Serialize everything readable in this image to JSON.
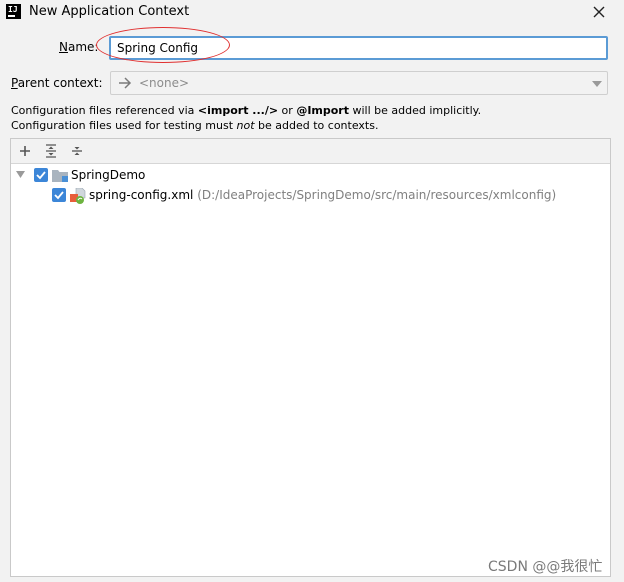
{
  "window": {
    "title": "New Application Context",
    "app_icon": "intellij-idea-icon",
    "app_icon_text": "IJ",
    "close_icon": "close-icon"
  },
  "form": {
    "name_label": "Name:",
    "name_mnemonic": "N",
    "name_rest": "ame:",
    "name_value": "Spring Config",
    "parent_label": "Parent context:",
    "parent_mnemonic": "P",
    "parent_rest": "arent context:",
    "parent_value": "<none>"
  },
  "info": {
    "line1_a": "Configuration files referenced via ",
    "line1_b": "<import .../>",
    "line1_c": " or ",
    "line1_d": "@Import",
    "line1_e": " will be added implicitly.",
    "line2_a": "Configuration files used for testing must ",
    "line2_b": "not",
    "line2_c": " be added to contexts."
  },
  "toolbar": {
    "buttons": [
      "add-icon",
      "expand-all-icon",
      "collapse-all-icon"
    ],
    "add_glyph": "+"
  },
  "tree": {
    "module": {
      "label": "SpringDemo",
      "checked": true,
      "expanded": true,
      "icon": "module-folder-icon"
    },
    "file": {
      "label": "spring-config.xml",
      "path": "(D:/IdeaProjects/SpringDemo/src/main/resources/xmlconfig)",
      "checked": true,
      "icon": "spring-xml-file-icon"
    }
  },
  "watermark": "CSDN @@我很忙",
  "colors": {
    "accent": "#3c86d8",
    "focus_border": "#5b9bd5",
    "annotation": "#e03030",
    "background": "#f2f2f2"
  }
}
